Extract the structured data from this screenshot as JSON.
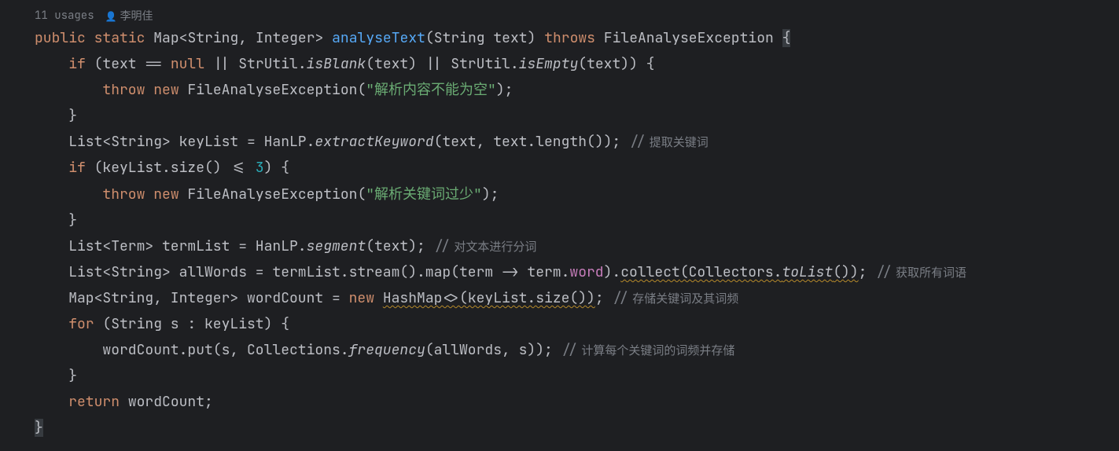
{
  "inlay": {
    "usages": "11 usages",
    "author_icon": "👤",
    "author": "李明佳"
  },
  "code": {
    "kw_public": "public",
    "kw_static": "static",
    "type_map": "Map",
    "lt": "<",
    "type_string": "String",
    "comma_sp": ", ",
    "type_integer": "Integer",
    "gt": ">",
    "sp": " ",
    "fn_analyseText": "analyseText",
    "lp": "(",
    "param_text": "String text",
    "rp": ")",
    "kw_throws": "throws",
    "ex_type": "FileAnalyseException",
    "brace_open": " {",
    "brace_open_hl": "{",
    "kw_if": "if",
    "cond_null": " (text == ",
    "kw_null": "null",
    "cond_or1": " || StrUtil.",
    "isBlank": "isBlank",
    "isEmpty": "isEmpty",
    "txt_arg": "(text)",
    "cond_or2": " || StrUtil.",
    "cond_close": ") {",
    "kw_throw": "throw",
    "kw_new": "new",
    "ctor_ex": "FileAnalyseException",
    "str_empty": "\"解析内容不能为空\"",
    "call_close_semi": ");",
    "brace_close": "}",
    "list_decl1": "List<String> keyList = HanLP.",
    "extractKeyword": "extractKeyword",
    "ek_args": "(text, text.length()); ",
    "cmt_sl": "//",
    "cmt1": " 提取关键词",
    "if2": " (keyList.size() <= ",
    "num3": "3",
    "if2_close": ") {",
    "str_few": "\"解析关键词过少\"",
    "term_decl": "List<Term> termList = HanLP.",
    "segment": "segment",
    "seg_args": "(text); ",
    "cmt2": " 对文本进行分词",
    "allw_pre": "List<String> allWords = termList.stream().map(term -> term.",
    "word": "word",
    "allw_mid": ").",
    "collect": "collect",
    "collectors_pre": "(Collectors.",
    "toList": "toList",
    "allw_post": "()); ",
    "cmt3": " 获取所有词语",
    "wc_pre": "Map<String, Integer> wordCount = ",
    "hashmap": "HashMap<>(keyList.size())",
    "wc_post": "; ",
    "cmt4": " 存储关键词及其词频",
    "kw_for": "for",
    "for_head": " (String s : keyList) {",
    "put_line": "wordCount.put(s, Collections.",
    "frequency": "frequency",
    "freq_args": "(allWords, s)); ",
    "cmt5": " 计算每个关键词的词频并存储",
    "kw_return": "return",
    "ret_expr": " wordCount;"
  }
}
